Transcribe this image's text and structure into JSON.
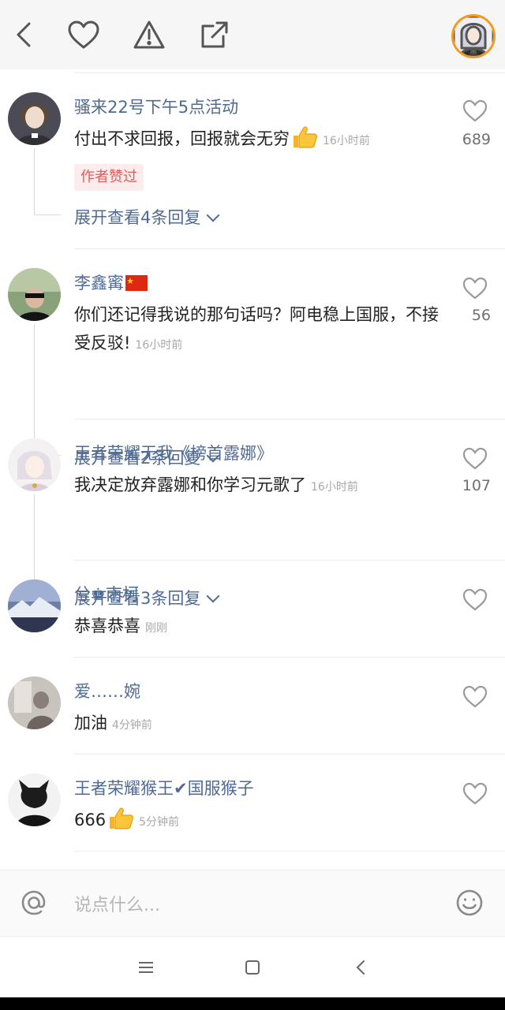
{
  "topbar": {
    "icons": [
      "back-icon",
      "heart-icon",
      "report-warning-icon",
      "share-icon"
    ],
    "avatar": "user-avatar"
  },
  "comments": [
    {
      "username": "骚来22号下午5点活动",
      "text": "付出不求回报，回报就会无穷",
      "emoji": "thumbs-up-icon",
      "time": "16小时前",
      "likes": "689",
      "badge": "作者赞过",
      "expand": "展开查看4条回复"
    },
    {
      "username": "李鑫寗",
      "flag": "china-flag-icon",
      "text": "你们还记得我说的那句话吗？阿电稳上国服，不接受反驳!",
      "time": "16小时前",
      "likes": "56",
      "expand": "展开查看2条回复"
    },
    {
      "username": "王者荣耀无我《榜首露娜》",
      "text": "我决定放弃露娜和你学习元歌了",
      "time": "16小时前",
      "likes": "107",
      "expand": "展开查看3条回复"
    },
    {
      "username": "兮♚南柯",
      "text": "恭喜恭喜",
      "time": "刚刚",
      "likes": ""
    },
    {
      "username": "爱……婉",
      "text": "加油",
      "time": "4分钟前",
      "likes": ""
    },
    {
      "username": "王者荣耀猴王✔国服猴子",
      "text": "666",
      "emoji": "thumbs-up-icon",
      "time": "5分钟前",
      "likes": ""
    }
  ],
  "input": {
    "placeholder": "说点什么..."
  },
  "colors": {
    "username": "#4f6a93",
    "badge_bg": "#fdecec",
    "badge_text": "#e25a5a",
    "avatar_ring": "#f39a1c"
  }
}
